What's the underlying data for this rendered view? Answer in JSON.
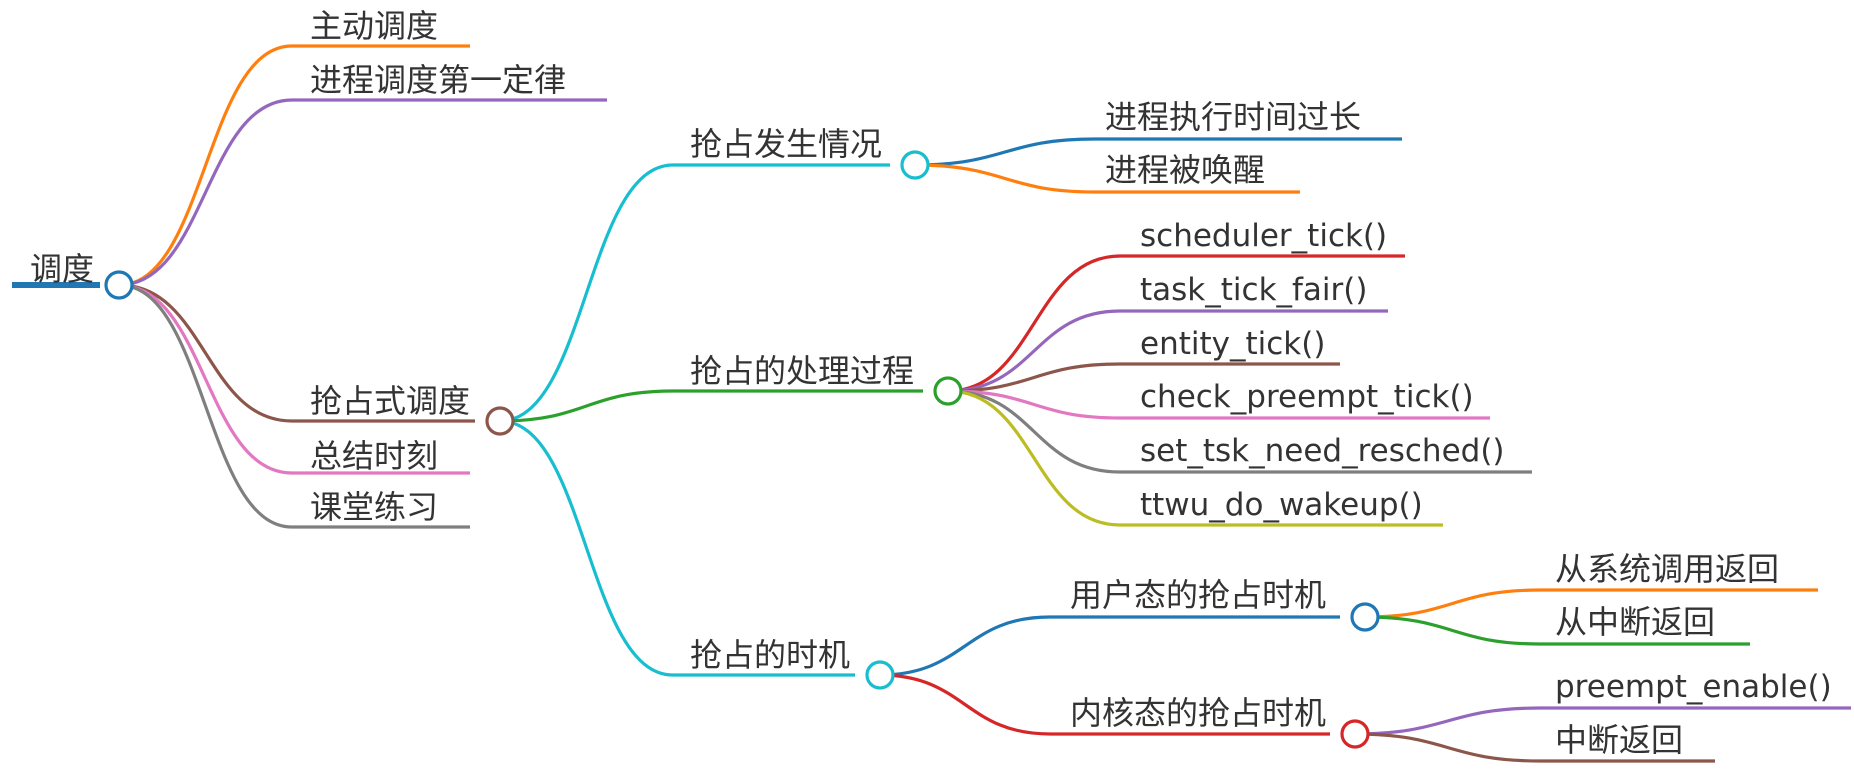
{
  "root": {
    "label": "调度",
    "color": "#1f77b4",
    "children": [
      {
        "id": "active",
        "label": "主动调度",
        "color": "#ff7f0e"
      },
      {
        "id": "first-law",
        "label": "进程调度第一定律",
        "color": "#9467bd"
      },
      {
        "id": "preemptive",
        "label": "抢占式调度",
        "color": "#8c564b",
        "children": [
          {
            "id": "occurrence",
            "label": "抢占发生情况",
            "color": "#17becf",
            "children": [
              {
                "id": "too-long",
                "label": "进程执行时间过长",
                "color": "#1f77b4"
              },
              {
                "id": "woken",
                "label": "进程被唤醒",
                "color": "#ff7f0e"
              }
            ]
          },
          {
            "id": "process",
            "label": "抢占的处理过程",
            "color": "#2ca02c",
            "children": [
              {
                "id": "scheduler-tick",
                "label": "scheduler_tick()",
                "color": "#d62728"
              },
              {
                "id": "task-tick-fair",
                "label": "task_tick_fair()",
                "color": "#9467bd"
              },
              {
                "id": "entity-tick",
                "label": "entity_tick()",
                "color": "#8c564b"
              },
              {
                "id": "check-preempt-tick",
                "label": "check_preempt_tick()",
                "color": "#e377c2"
              },
              {
                "id": "set-tsk-need-resched",
                "label": "set_tsk_need_resched()",
                "color": "#7f7f7f"
              },
              {
                "id": "ttwu-do-wakeup",
                "label": "ttwu_do_wakeup()",
                "color": "#bcbd22"
              }
            ]
          },
          {
            "id": "timing",
            "label": "抢占的时机",
            "color": "#17becf",
            "children": [
              {
                "id": "user-mode",
                "label": "用户态的抢占时机",
                "color": "#1f77b4",
                "children": [
                  {
                    "id": "from-syscall",
                    "label": "从系统调用返回",
                    "color": "#ff7f0e"
                  },
                  {
                    "id": "from-interrupt",
                    "label": "从中断返回",
                    "color": "#2ca02c"
                  }
                ]
              },
              {
                "id": "kernel-mode",
                "label": "内核态的抢占时机",
                "color": "#d62728",
                "children": [
                  {
                    "id": "preempt-enable",
                    "label": "preempt_enable()",
                    "color": "#9467bd"
                  },
                  {
                    "id": "interrupt-return",
                    "label": "中断返回",
                    "color": "#8c564b"
                  }
                ]
              }
            ]
          }
        ]
      },
      {
        "id": "summary",
        "label": "总结时刻",
        "color": "#e377c2"
      },
      {
        "id": "exercise",
        "label": "课堂练习",
        "color": "#7f7f7f"
      }
    ]
  }
}
